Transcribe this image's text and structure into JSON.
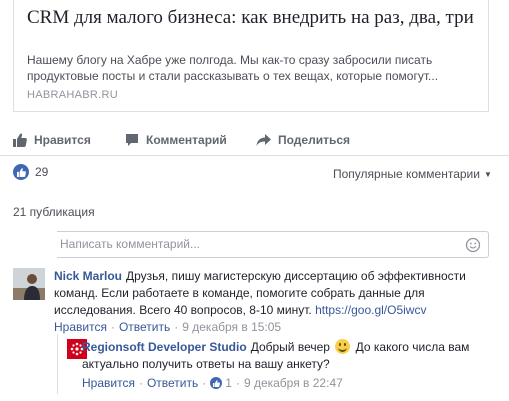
{
  "link_card": {
    "title": "CRM для малого бизнеса: как внедрить на раз, два, три",
    "description": "Нашему блогу на Хабре уже полгода. Мы как-то сразу забросили писать продуктовые посты и стали рассказывать о тех вещах, которые помогут...",
    "domain": "HABRAHABR.RU"
  },
  "actions": {
    "like": "Нравится",
    "comment": "Комментарий",
    "share": "Поделиться"
  },
  "reactions": {
    "count": "29",
    "sort_label": "Популярные комментарии"
  },
  "publications": "21 публикация",
  "compose": {
    "placeholder": "Написать комментарий..."
  },
  "comment": {
    "author": "Nick Marlou",
    "text": "Друзья, пишу магистерскую диссертацию об эффективности команд. Если работаете в команде, помогите собрать данные для исследования. Всего 40 вопросов, 8-10 минут.",
    "link": "https://goo.gl/O5iwcv",
    "like_label": "Нравится",
    "reply_label": "Ответить",
    "date": "9 декабря в 15:05"
  },
  "reply": {
    "author": "Regionsoft Developer Studio",
    "text_before": "Добрый вечер",
    "text_after": "До какого числа вам актуально получить ответы на вашу анкету?",
    "like_label": "Нравится",
    "reply_label": "Ответить",
    "likes": "1",
    "date": "9 декабря в 22:47"
  },
  "colors": {
    "link": "#365899",
    "like_blue": "#4267b2",
    "brand_red": "#d0021b"
  },
  "icons": [
    "thumbs-up-icon",
    "comment-bubble-icon",
    "share-arrow-icon",
    "smiley-icon",
    "sort-caret-icon",
    "regionsoft-logo-icon",
    "smile-emoji-icon"
  ]
}
